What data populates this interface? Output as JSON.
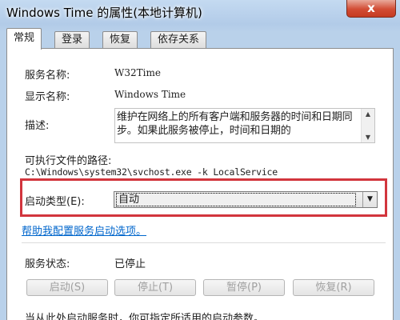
{
  "window": {
    "title": "Windows Time 的属性(本地计算机)",
    "close": "x"
  },
  "tabs": [
    {
      "label": "常规",
      "active": true
    },
    {
      "label": "登录",
      "active": false
    },
    {
      "label": "恢复",
      "active": false
    },
    {
      "label": "依存关系",
      "active": false
    }
  ],
  "general": {
    "service_name_label": "服务名称:",
    "service_name_value": "W32Time",
    "display_name_label": "显示名称:",
    "display_name_value": "Windows Time",
    "description_label": "描述:",
    "description_value": "维护在网络上的所有客户端和服务器的时间和日期同步。如果此服务被停止，时间和日期的",
    "exe_path_label": "可执行文件的路径:",
    "exe_path_value": "C:\\Windows\\system32\\svchost.exe -k LocalService",
    "startup_type_label": "启动类型(E):",
    "startup_type_value": "自动",
    "help_link": "帮助我配置服务启动选项。",
    "service_status_label": "服务状态:",
    "service_status_value": "已停止",
    "buttons": {
      "start": "启动(S)",
      "stop": "停止(T)",
      "pause": "暂停(P)",
      "resume": "恢复(R)"
    },
    "start_params_hint": "当从此处启动服务时，你可指定所适用的启动参数。"
  }
}
